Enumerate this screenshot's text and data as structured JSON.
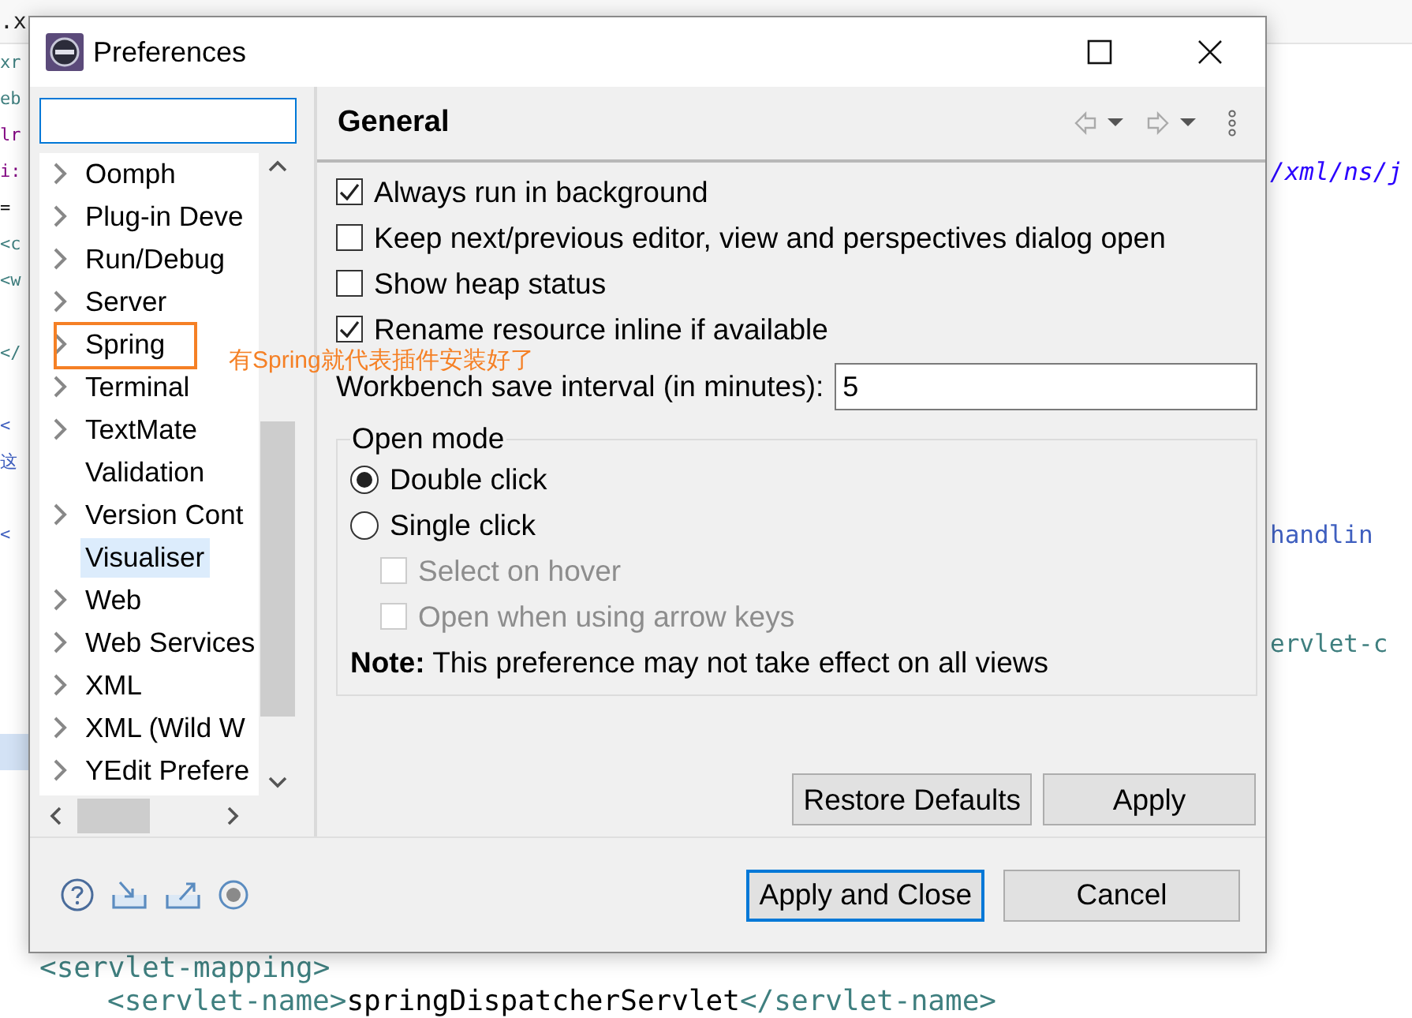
{
  "editor": {
    "tab": ".x",
    "lines": [
      {
        "left": {
          "text": "xr",
          "kind": "tag"
        },
        "highlighted": false
      },
      {
        "left": {
          "text": "eb",
          "kind": "tag"
        },
        "highlighted": false
      },
      {
        "left": {
          "text": "lr",
          "kind": "attr"
        },
        "highlighted": false
      },
      {
        "left": {
          "text": "i:",
          "kind": "attr"
        },
        "right": {
          "text": "/xml/ns/j",
          "kind": "string"
        },
        "highlighted": false
      },
      {
        "left": {
          "text": "=",
          "kind": "plain"
        },
        "highlighted": false
      },
      {
        "left": {
          "text": "<c",
          "kind": "tag"
        },
        "highlighted": false
      },
      {
        "left": {
          "text": "<w",
          "kind": "tag"
        },
        "highlighted": false
      },
      {
        "highlighted": false
      },
      {
        "left": {
          "text": "</",
          "kind": "tag"
        },
        "highlighted": false
      },
      {
        "highlighted": false
      },
      {
        "left": {
          "text": "<",
          "kind": "comment"
        },
        "highlighted": false
      },
      {
        "left": {
          "text": "这",
          "kind": "comment"
        },
        "highlighted": false
      },
      {
        "highlighted": false
      },
      {
        "left": {
          "text": "<",
          "kind": "comment"
        },
        "right": {
          "text": "handlin",
          "kind": "comment"
        },
        "highlighted": false
      },
      {
        "highlighted": false
      },
      {
        "highlighted": false
      },
      {
        "right": {
          "text": "ervlet-c",
          "kind": "tag"
        },
        "highlighted": false
      },
      {
        "highlighted": false
      },
      {
        "highlighted": false
      },
      {
        "highlighted": true
      },
      {
        "highlighted": false
      },
      {
        "highlighted": false
      },
      {
        "highlighted": false
      },
      {
        "highlighted": false
      },
      {
        "highlighted": false
      }
    ],
    "block": {
      "segments": [
        {
          "text": "<servlet-mapping>",
          "kind": "tag"
        }
      ],
      "children": [
        {
          "segments": [
            {
              "text": "<servlet-name>",
              "kind": "tag"
            },
            {
              "text": "springDispatcherServlet",
              "kind": "plain"
            },
            {
              "text": "</servlet-name>",
              "kind": "tag"
            }
          ]
        }
      ]
    }
  },
  "window": {
    "title": "Preferences"
  },
  "tree": {
    "items": [
      {
        "label": "Oomph",
        "has_children": true,
        "selected": false,
        "annotated": false
      },
      {
        "label": "Plug-in Deve",
        "has_children": true,
        "selected": false,
        "annotated": false
      },
      {
        "label": "Run/Debug",
        "has_children": true,
        "selected": false,
        "annotated": false
      },
      {
        "label": "Server",
        "has_children": true,
        "selected": false,
        "annotated": false
      },
      {
        "label": "Spring",
        "has_children": true,
        "selected": false,
        "annotated": true
      },
      {
        "label": "Terminal",
        "has_children": true,
        "selected": false,
        "annotated": false
      },
      {
        "label": "TextMate",
        "has_children": true,
        "selected": false,
        "annotated": false
      },
      {
        "label": "Validation",
        "has_children": false,
        "selected": false,
        "annotated": false
      },
      {
        "label": "Version Cont",
        "has_children": true,
        "selected": false,
        "annotated": false
      },
      {
        "label": "Visualiser",
        "has_children": false,
        "selected": true,
        "annotated": false
      },
      {
        "label": "Web",
        "has_children": true,
        "selected": false,
        "annotated": false
      },
      {
        "label": "Web Services",
        "has_children": true,
        "selected": false,
        "annotated": false
      },
      {
        "label": "XML",
        "has_children": true,
        "selected": false,
        "annotated": false
      },
      {
        "label": "XML (Wild W",
        "has_children": true,
        "selected": false,
        "annotated": false
      },
      {
        "label": "YEdit Prefere",
        "has_children": true,
        "selected": false,
        "annotated": false
      }
    ]
  },
  "annotation": {
    "text": "有Spring就代表插件安装好了"
  },
  "page": {
    "title": "General",
    "checkboxes": [
      {
        "label": "Always run in background",
        "checked": true
      },
      {
        "label": "Keep next/previous editor, view and perspectives dialog open",
        "checked": false
      },
      {
        "label": "Show heap status",
        "checked": false
      },
      {
        "label": "Rename resource inline if available",
        "checked": true
      }
    ],
    "save_interval": {
      "label": "Workbench save interval (in minutes):",
      "value": "5"
    },
    "open_mode": {
      "title": "Open mode",
      "options": [
        {
          "label": "Double click",
          "selected": true
        },
        {
          "label": "Single click",
          "selected": false
        }
      ],
      "sub_options": [
        {
          "label": "Select on hover",
          "checked": false,
          "disabled": true
        },
        {
          "label": "Open when using arrow keys",
          "checked": false,
          "disabled": true
        }
      ],
      "note": "**Note:** This preference may not take effect on all views"
    },
    "buttons": [
      "Restore Defaults",
      "Apply"
    ]
  },
  "footer_buttons": [
    {
      "label": "Apply and Close",
      "default": true
    },
    {
      "label": "Cancel",
      "default": false
    }
  ]
}
